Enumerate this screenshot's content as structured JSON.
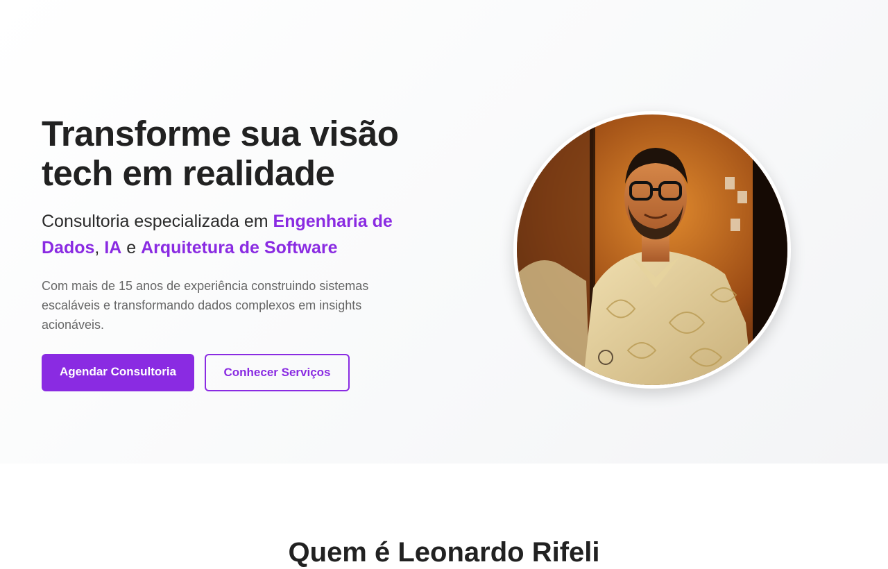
{
  "hero": {
    "headline": "Transforme sua visão tech em realidade",
    "subheadline": {
      "prefix": "Consultoria especializada em ",
      "highlight_1": "Engenharia de Dados",
      "separator_1": ", ",
      "highlight_2": "IA",
      "separator_2": " e ",
      "highlight_3": "Arquitetura de Software"
    },
    "description": "Com mais de 15 anos de experiência construindo sistemas escaláveis e transformando dados complexos em insights acionáveis.",
    "primary_button_label": "Agendar Consultoria",
    "secondary_button_label": "Conhecer Serviços",
    "portrait_alt": "Leonardo Rifeli"
  },
  "about": {
    "title": "Quem é Leonardo Rifeli"
  },
  "colors": {
    "accent": "#8a2be2",
    "text_dark": "#212121",
    "text_muted": "#666666",
    "hero_background": "#f8f9fa"
  }
}
